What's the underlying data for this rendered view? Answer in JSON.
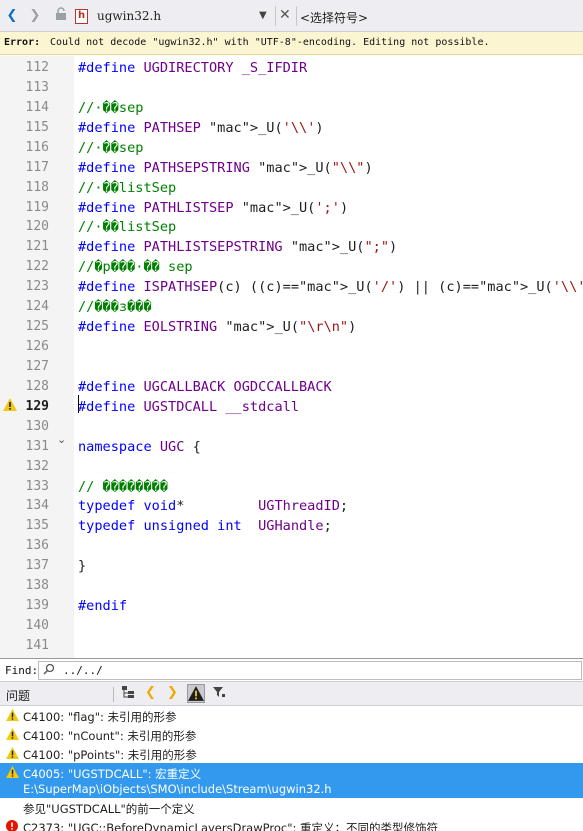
{
  "tabbar": {
    "file_name": "ugwin32.h",
    "symbol_selector": "<选择符号>"
  },
  "error_bar": {
    "label": "Error:",
    "message": "Could not decode \"ugwin32.h\" with \"UTF-8\"-encoding. Editing not possible."
  },
  "editor": {
    "active_line": "129",
    "lines": [
      {
        "n": "112",
        "t": "#define UGDIRECTORY _S_IFDIR"
      },
      {
        "n": "113",
        "t": ""
      },
      {
        "n": "114",
        "t": "//·��sep"
      },
      {
        "n": "115",
        "t": "#define PATHSEP _U('\\\\')"
      },
      {
        "n": "116",
        "t": "//·��sep"
      },
      {
        "n": "117",
        "t": "#define PATHSEPSTRING _U(\"\\\\\")"
      },
      {
        "n": "118",
        "t": "//·��listSep"
      },
      {
        "n": "119",
        "t": "#define PATHLISTSEP _U(';')"
      },
      {
        "n": "120",
        "t": "//·��listSep"
      },
      {
        "n": "121",
        "t": "#define PATHLISTSEPSTRING _U(\";\")"
      },
      {
        "n": "122",
        "t": "//�p���·�� sep"
      },
      {
        "n": "123",
        "t": "#define ISPATHSEP(c) ((c)==_U('/') || (c)==_U('\\\\'))"
      },
      {
        "n": "124",
        "t": "//���з���"
      },
      {
        "n": "125",
        "t": "#define EOLSTRING _U(\"\\r\\n\")"
      },
      {
        "n": "126",
        "t": ""
      },
      {
        "n": "127",
        "t": ""
      },
      {
        "n": "128",
        "t": "#define UGCALLBACK OGDCCALLBACK"
      },
      {
        "n": "129",
        "t": "#define UGSTDCALL __stdcall"
      },
      {
        "n": "130",
        "t": ""
      },
      {
        "n": "131",
        "t": "namespace UGC {"
      },
      {
        "n": "132",
        "t": ""
      },
      {
        "n": "133",
        "t": "// ��������"
      },
      {
        "n": "134",
        "t": "typedef void*         UGThreadID;"
      },
      {
        "n": "135",
        "t": "typedef unsigned int  UGHandle;"
      },
      {
        "n": "136",
        "t": ""
      },
      {
        "n": "137",
        "t": "}"
      },
      {
        "n": "138",
        "t": ""
      },
      {
        "n": "139",
        "t": "#endif"
      },
      {
        "n": "140",
        "t": ""
      },
      {
        "n": "141",
        "t": ""
      }
    ]
  },
  "find": {
    "label": "Find:",
    "path": "../../"
  },
  "problems": {
    "title": "问题",
    "rows": [
      {
        "kind": "warning",
        "text": "C4100: \"flag\": 未引用的形参"
      },
      {
        "kind": "warning",
        "text": "C4100: \"nCount\": 未引用的形参"
      },
      {
        "kind": "warning",
        "text": "C4100: \"pPoints\": 未引用的形参"
      },
      {
        "kind": "warning",
        "text": "C4005: \"UGSTDCALL\": 宏重定义",
        "text2": "E:\\SuperMap\\iObjects\\SMO\\include\\Stream\\ugwin32.h",
        "selected": true
      },
      {
        "kind": "note",
        "text": "参见\"UGSTDCALL\"的前一个定义"
      },
      {
        "kind": "error",
        "text": "C2373: \"UGC::BeforeDynamicLayersDrawProc\": 重定义；不同的类型修饰符"
      }
    ]
  },
  "colors": {
    "accent": "#0e70c0",
    "selection": "#3399ee",
    "warning": "#f2c811",
    "error": "#e51400"
  }
}
